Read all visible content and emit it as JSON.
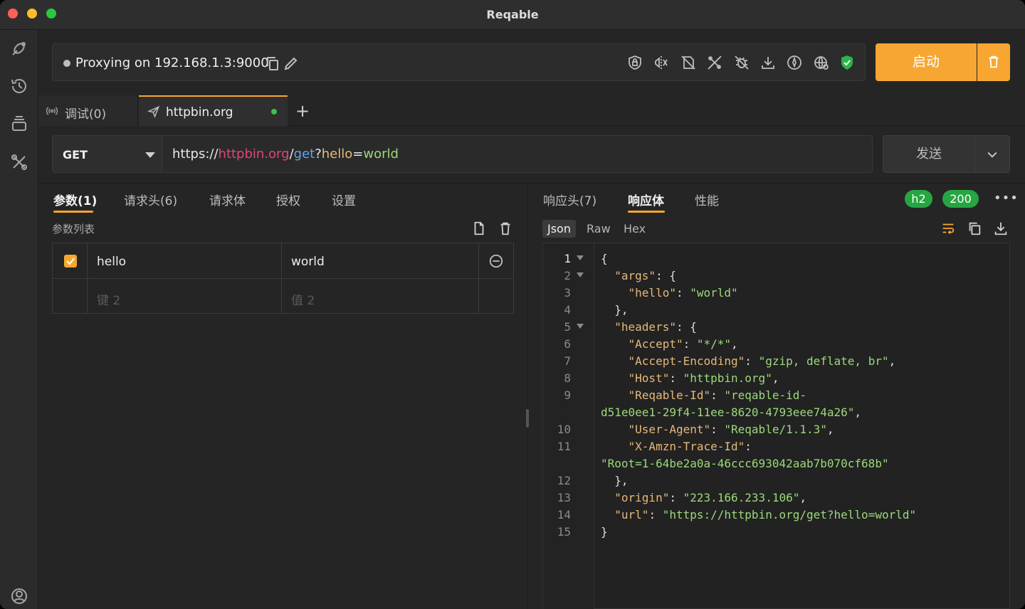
{
  "window": {
    "title": "Reqable"
  },
  "proxy": {
    "status_text": "Proxying on 192.168.1.3:9000"
  },
  "actions": {
    "start_label": "启动"
  },
  "tabs": [
    {
      "label": "调试(0)"
    },
    {
      "label": "httpbin.org"
    }
  ],
  "request": {
    "method": "GET",
    "url_parts": {
      "scheme": "https://",
      "host": "httpbin.org",
      "slash": "/",
      "path": "get",
      "q": "?",
      "key": "hello",
      "eq": "=",
      "value": "world"
    },
    "send_label": "发送"
  },
  "request_tabs": [
    "参数(1)",
    "请求头(6)",
    "请求体",
    "授权",
    "设置"
  ],
  "params": {
    "title": "参数列表",
    "rows": [
      {
        "key": "hello",
        "value": "world"
      }
    ],
    "placeholder_key": "键 2",
    "placeholder_value": "值 2"
  },
  "response_tabs": [
    "响应头(7)",
    "响应体",
    "性能"
  ],
  "response": {
    "protocol": "h2",
    "status": "200",
    "formats": [
      "Json",
      "Raw",
      "Hex"
    ],
    "line_numbers": [
      "1",
      "2",
      "3",
      "4",
      "5",
      "6",
      "7",
      "8",
      "9",
      "10",
      "11",
      "12",
      "13",
      "14",
      "15"
    ]
  },
  "colors": {
    "accent": "#f7a731",
    "success": "#26a642",
    "url_host": "#e0457b",
    "url_path": "#5aa7f0",
    "url_query_key": "#e6b87a",
    "url_query_value": "#9bd97a"
  },
  "icons": [
    "satellite-icon",
    "history-icon",
    "collections-icon",
    "tools-icon",
    "account-icon",
    "copy-icon",
    "edit-icon",
    "trash-icon",
    "chevron-down-icon",
    "send-icon",
    "antenna-icon"
  ]
}
